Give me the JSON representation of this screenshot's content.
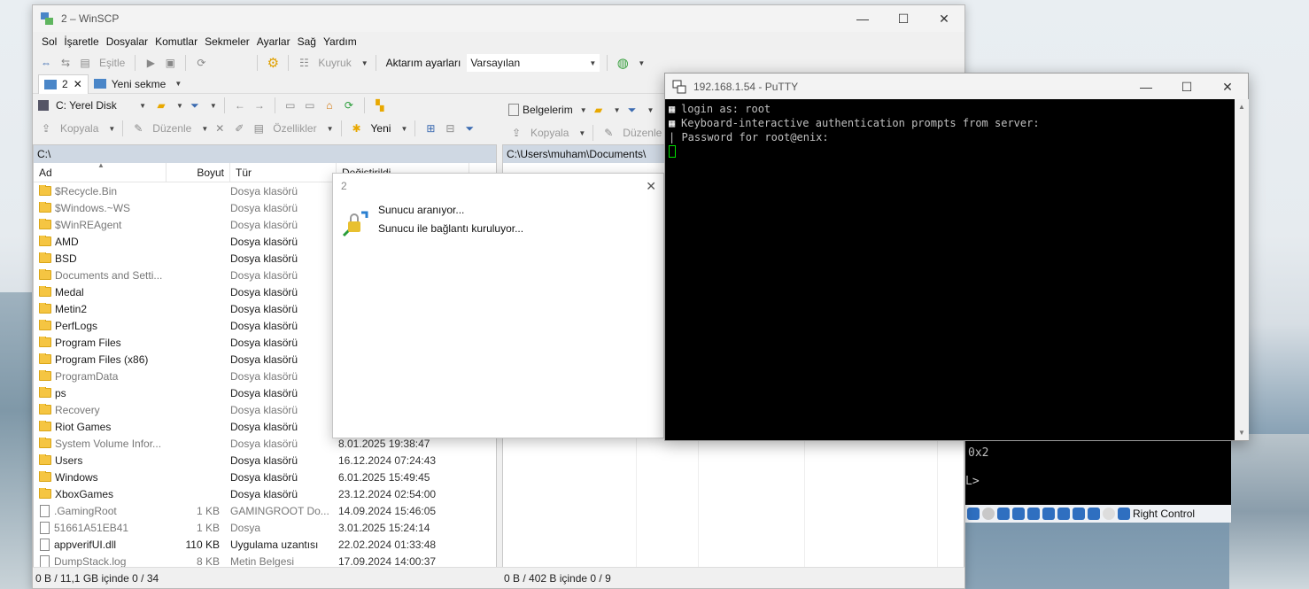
{
  "winscp": {
    "title": "2 – WinSCP",
    "menu": [
      "Sol",
      "İşaretle",
      "Dosyalar",
      "Komutlar",
      "Sekmeler",
      "Ayarlar",
      "Sağ",
      "Yardım"
    ],
    "toolbar": {
      "sync_label": "Eşitle",
      "queue_label": "Kuyruk",
      "transfer_settings_label": "Aktarım ayarları",
      "transfer_preset": "Varsayılan"
    },
    "tabs": [
      {
        "label": "2"
      },
      {
        "label": "Yeni sekme"
      }
    ],
    "left": {
      "drive": "C: Yerel Disk",
      "copy_label": "Kopyala",
      "edit_label": "Düzenle",
      "properties_label": "Özellikler",
      "new_label": "Yeni",
      "path": "C:\\",
      "columns": {
        "name": "Ad",
        "size": "Boyut",
        "type": "Tür",
        "changed": "Değiştirildi"
      },
      "rows": [
        {
          "name": "$Recycle.Bin",
          "size": "",
          "type": "Dosya klasörü",
          "date": "",
          "kind": "folder",
          "dim": true
        },
        {
          "name": "$Windows.~WS",
          "size": "",
          "type": "Dosya klasörü",
          "date": "",
          "kind": "folder",
          "dim": true
        },
        {
          "name": "$WinREAgent",
          "size": "",
          "type": "Dosya klasörü",
          "date": "",
          "kind": "folder",
          "dim": true
        },
        {
          "name": "AMD",
          "size": "",
          "type": "Dosya klasörü",
          "date": "",
          "kind": "folder",
          "dim": false
        },
        {
          "name": "BSD",
          "size": "",
          "type": "Dosya klasörü",
          "date": "",
          "kind": "folder",
          "dim": false
        },
        {
          "name": "Documents and Setti...",
          "size": "",
          "type": "Dosya klasörü",
          "date": "",
          "kind": "folder",
          "dim": true
        },
        {
          "name": "Medal",
          "size": "",
          "type": "Dosya klasörü",
          "date": "",
          "kind": "folder",
          "dim": false
        },
        {
          "name": "Metin2",
          "size": "",
          "type": "Dosya klasörü",
          "date": "",
          "kind": "folder",
          "dim": false
        },
        {
          "name": "PerfLogs",
          "size": "",
          "type": "Dosya klasörü",
          "date": "",
          "kind": "folder",
          "dim": false
        },
        {
          "name": "Program Files",
          "size": "",
          "type": "Dosya klasörü",
          "date": "",
          "kind": "folder",
          "dim": false
        },
        {
          "name": "Program Files (x86)",
          "size": "",
          "type": "Dosya klasörü",
          "date": "",
          "kind": "folder",
          "dim": false
        },
        {
          "name": "ProgramData",
          "size": "",
          "type": "Dosya klasörü",
          "date": "",
          "kind": "folder",
          "dim": true
        },
        {
          "name": "ps",
          "size": "",
          "type": "Dosya klasörü",
          "date": "",
          "kind": "folder",
          "dim": false
        },
        {
          "name": "Recovery",
          "size": "",
          "type": "Dosya klasörü",
          "date": "",
          "kind": "folder",
          "dim": true
        },
        {
          "name": "Riot Games",
          "size": "",
          "type": "Dosya klasörü",
          "date": "",
          "kind": "folder",
          "dim": false
        },
        {
          "name": "System Volume Infor...",
          "size": "",
          "type": "Dosya klasörü",
          "date": "8.01.2025 19:38:47",
          "kind": "folder",
          "dim": true
        },
        {
          "name": "Users",
          "size": "",
          "type": "Dosya klasörü",
          "date": "16.12.2024 07:24:43",
          "kind": "folder",
          "dim": false
        },
        {
          "name": "Windows",
          "size": "",
          "type": "Dosya klasörü",
          "date": "6.01.2025 15:49:45",
          "kind": "folder",
          "dim": false
        },
        {
          "name": "XboxGames",
          "size": "",
          "type": "Dosya klasörü",
          "date": "23.12.2024 02:54:00",
          "kind": "folder",
          "dim": false
        },
        {
          "name": ".GamingRoot",
          "size": "1 KB",
          "type": "GAMINGROOT Do...",
          "date": "14.09.2024 15:46:05",
          "kind": "file",
          "dim": true
        },
        {
          "name": "51661A51EB41",
          "size": "1 KB",
          "type": "Dosya",
          "date": "3.01.2025 15:24:14",
          "kind": "file",
          "dim": true
        },
        {
          "name": "appverifUI.dll",
          "size": "110 KB",
          "type": "Uygulama uzantısı",
          "date": "22.02.2024 01:33:48",
          "kind": "file",
          "dim": false
        },
        {
          "name": "DumpStack.log",
          "size": "8 KB",
          "type": "Metin Belgesi",
          "date": "17.09.2024 14:00:37",
          "kind": "file",
          "dim": true
        }
      ],
      "status": "0 B / 11,1 GB içinde 0 / 34"
    },
    "right": {
      "drive": "Belgelerim",
      "copy_label": "Kopyala",
      "edit_label": "Düzenle",
      "path": "C:\\Users\\muham\\Documents\\",
      "status": "0 B / 402 B içinde 0 / 9"
    }
  },
  "dialog": {
    "title": "2",
    "line1": "Sunucu aranıyor...",
    "line2": "Sunucu ile bağlantı kuruluyor..."
  },
  "putty": {
    "title": "192.168.1.54 - PuTTY",
    "lines": [
      "login as: root",
      "Keyboard-interactive authentication prompts from server:",
      "| Password for root@enix:"
    ]
  },
  "vbox": {
    "line1": "0x2",
    "line2": "L>",
    "host_key": "Right Control"
  }
}
